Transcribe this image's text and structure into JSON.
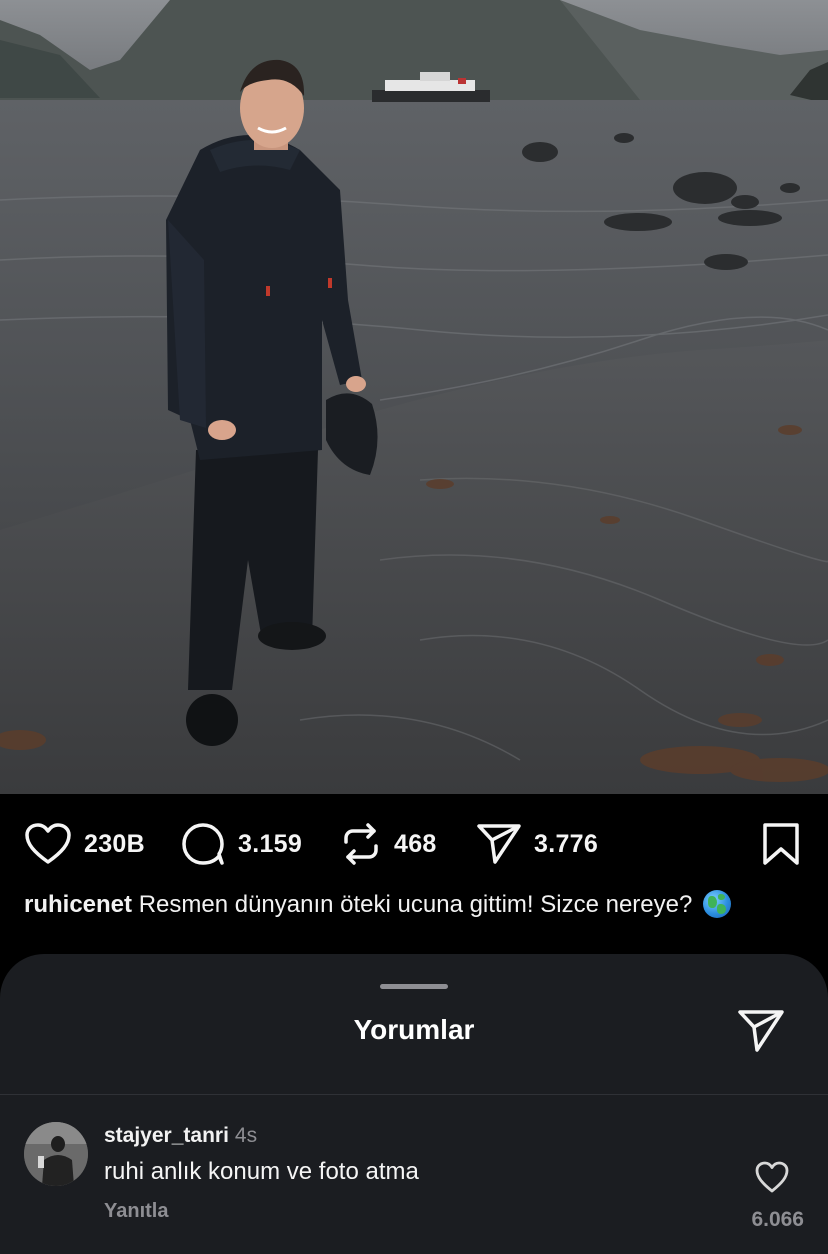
{
  "post": {
    "actions": {
      "likes": "230B",
      "comments": "3.159",
      "reposts": "468",
      "shares": "3.776"
    },
    "caption": {
      "username": "ruhicenet",
      "text": "Resmen dünyanın öteki ucuna gittim! Sizce nereye?"
    },
    "icons": {
      "like": "heart-icon",
      "comment": "comment-bubble-icon",
      "repost": "repost-icon",
      "share": "send-icon",
      "save": "bookmark-icon"
    }
  },
  "comments_sheet": {
    "title": "Yorumlar",
    "comments": [
      {
        "username": "stajyer_tanri",
        "time": "4s",
        "text": "ruhi anlık konum ve foto atma",
        "reply_label": "Yanıtla",
        "likes": "6.066"
      }
    ]
  },
  "colors": {
    "background": "#000000",
    "sheet": "#1b1d21",
    "text_primary": "#f5f5f5",
    "text_secondary": "#8e8e93"
  }
}
